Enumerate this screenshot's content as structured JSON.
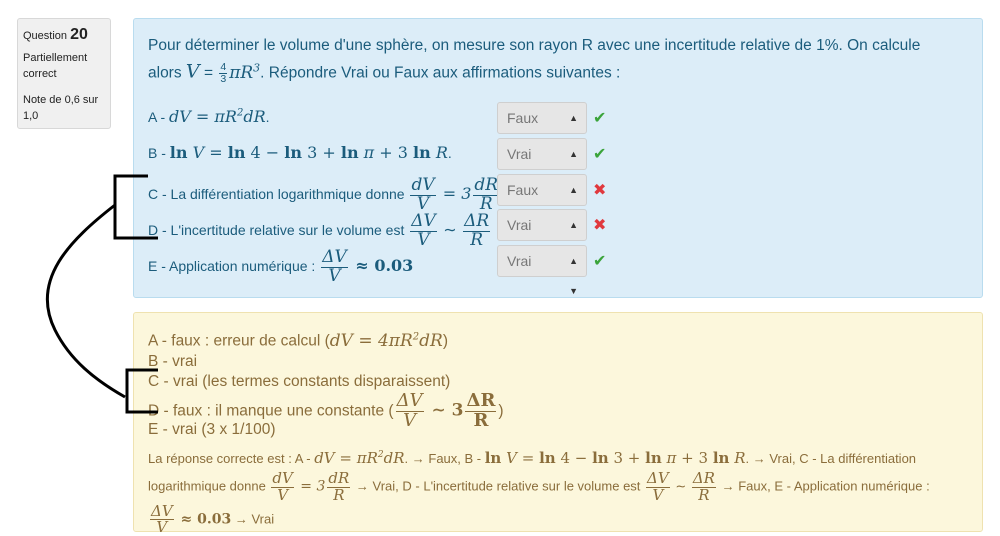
{
  "info": {
    "question_label": "Question",
    "question_number": "20",
    "state": "Partiellement correct",
    "grade": "Note de 0,6 sur 1,0"
  },
  "question": {
    "text_line1": "Pour déterminer le volume d'une sphère, on mesure son rayon R avec une incertitude relative de 1%. On calcule",
    "text_alors": "alors",
    "text_after_formula": ". Répondre Vrai ou Faux aux affirmations suivantes :",
    "rows": [
      {
        "prefix": "A - ",
        "selected": "Faux",
        "correct": true
      },
      {
        "prefix": "B - ",
        "selected": "Vrai",
        "correct": true
      },
      {
        "prefix": "C - La différentiation logarithmique donne ",
        "selected": "Faux",
        "correct": false
      },
      {
        "prefix": "D - L'incertitude relative sur le volume est ",
        "selected": "Vrai",
        "correct": false
      },
      {
        "prefix": "E - Application numérique : ",
        "selected": "Vrai",
        "correct": true
      }
    ]
  },
  "feedback": {
    "line_a": "A - faux : erreur de calcul (",
    "line_b": "B - vrai",
    "line_c": "C - vrai (les termes constants disparaissent)",
    "line_d": "D - faux : il manque une constante (",
    "line_e": "E - vrai (3 x 1/100)"
  },
  "right_answer": {
    "intro": "La réponse correcte est : A - ",
    "after_a": ". → Faux, B - ",
    "after_b": ". → Vrai, C - La différentiation",
    "line2_start": "logarithmique donne ",
    "after_c": " → Vrai, D - L'incertitude relative sur le volume est ",
    "after_d": " → Faux, E - Application numérique :",
    "after_e": " → Vrai"
  },
  "colors": {
    "question_bg": "#dcedf8",
    "question_text": "#1b5c7c",
    "feedback_bg": "#fcf7dc",
    "feedback_text": "#8a6d3b",
    "correct": "#3ba43b",
    "incorrect": "#e0393e"
  },
  "icons": {
    "correct": "check-icon",
    "incorrect": "cross-icon",
    "select": "updown-arrows-icon"
  }
}
